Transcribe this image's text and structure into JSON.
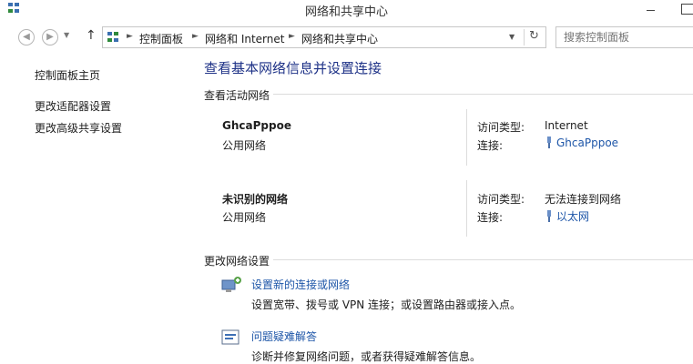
{
  "window": {
    "title": "网络和共享中心"
  },
  "addressbar": {
    "breadcrumbs": [
      "控制面板",
      "网络和 Internet",
      "网络和共享中心"
    ],
    "search_placeholder": "搜索控制面板"
  },
  "sidebar": {
    "items": [
      {
        "label": "控制面板主页"
      },
      {
        "label": "更改适配器设置"
      },
      {
        "label": "更改高级共享设置"
      }
    ]
  },
  "main": {
    "title": "查看基本网络信息并设置连接",
    "active_networks_heading": "查看活动网络",
    "networks": [
      {
        "name": "GhcaPppoe",
        "category": "公用网络",
        "access_label": "访问类型:",
        "access_value": "Internet",
        "connection_label": "连接:",
        "connection_value": "GhcaPppoe"
      },
      {
        "name": "未识别的网络",
        "category": "公用网络",
        "access_label": "访问类型:",
        "access_value": "无法连接到网络",
        "connection_label": "连接:",
        "connection_value": "以太网"
      }
    ],
    "change_settings_heading": "更改网络设置",
    "tasks": [
      {
        "link": "设置新的连接或网络",
        "description": "设置宽带、拨号或 VPN 连接；或设置路由器或接入点。"
      },
      {
        "link": "问题疑难解答",
        "description": "诊断并修复网络问题，或者获得疑难解答信息。"
      }
    ]
  },
  "colors": {
    "link": "#1e56a8",
    "title": "#1e3287"
  }
}
